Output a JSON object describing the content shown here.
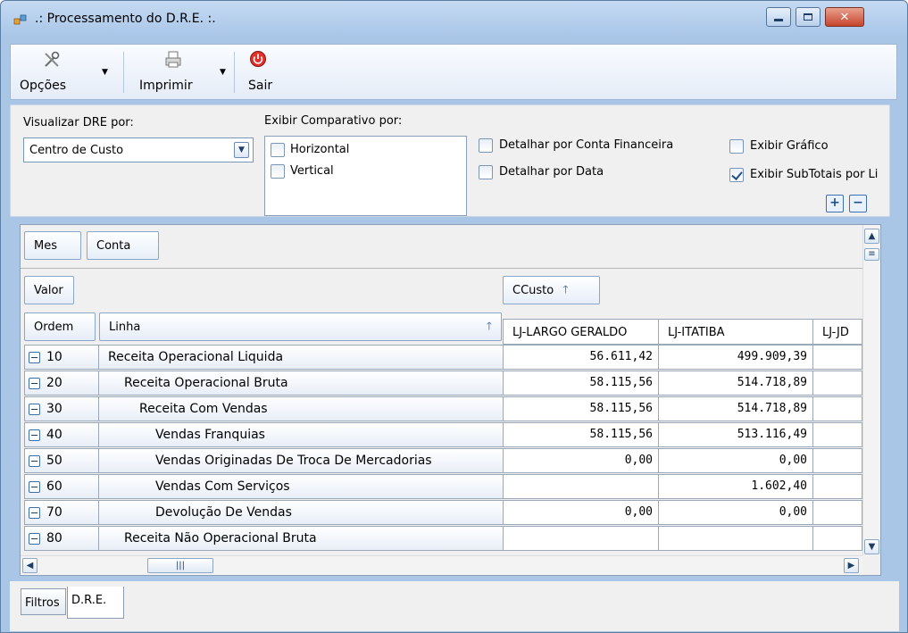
{
  "window": {
    "title": ".: Processamento do D.R.E. :."
  },
  "toolbar": {
    "options_label": "Opções",
    "print_label": "Imprimir",
    "exit_label": "Sair"
  },
  "filters": {
    "view_label": "Visualizar DRE por:",
    "view_value": "Centro de Custo",
    "compare_label": "Exibir Comparativo por:",
    "compare_options": [
      {
        "label": "Horizontal",
        "checked": false
      },
      {
        "label": "Vertical",
        "checked": false
      }
    ],
    "detail_account": {
      "label": "Detalhar por Conta Financeira",
      "checked": false
    },
    "detail_date": {
      "label": "Detalhar por Data",
      "checked": false
    },
    "show_chart": {
      "label": "Exibir Gráfico",
      "checked": false
    },
    "show_subtotals": {
      "label": "Exibir SubTotais por Li",
      "checked": true
    }
  },
  "grid": {
    "column_fields": [
      "Mes",
      "Conta"
    ],
    "data_field": "Valor",
    "ccusto_field": "CCusto",
    "row_fields": {
      "order": "Ordem",
      "line": "Linha"
    },
    "value_columns": [
      "LJ-LARGO GERALDO",
      "LJ-ITATIBA",
      "LJ-JD"
    ],
    "rows": [
      {
        "code": "10",
        "name": "Receita Operacional Liquida",
        "level": 0,
        "values": [
          "56.611,42",
          "499.909,39",
          ""
        ]
      },
      {
        "code": "20",
        "name": "Receita Operacional Bruta",
        "level": 1,
        "values": [
          "58.115,56",
          "514.718,89",
          ""
        ]
      },
      {
        "code": "30",
        "name": "Receita Com Vendas",
        "level": 2,
        "values": [
          "58.115,56",
          "514.718,89",
          ""
        ]
      },
      {
        "code": "40",
        "name": "Vendas Franquias",
        "level": 3,
        "values": [
          "58.115,56",
          "513.116,49",
          ""
        ]
      },
      {
        "code": "50",
        "name": "Vendas Originadas De Troca De Mercadorias",
        "level": 3,
        "values": [
          "0,00",
          "0,00",
          ""
        ]
      },
      {
        "code": "60",
        "name": "Vendas Com Serviços",
        "level": 3,
        "values": [
          "",
          "1.602,40",
          ""
        ]
      },
      {
        "code": "70",
        "name": "Devolução De Vendas",
        "level": 3,
        "values": [
          "0,00",
          "0,00",
          ""
        ]
      },
      {
        "code": "80",
        "name": "Receita Não Operacional Bruta",
        "level": 1,
        "values": [
          "",
          "",
          ""
        ]
      }
    ]
  },
  "tabs": {
    "filters": "Filtros",
    "dre": "D.R.E."
  },
  "icons": {
    "options": "tools-icon",
    "print": "printer-icon",
    "exit": "power-icon"
  }
}
